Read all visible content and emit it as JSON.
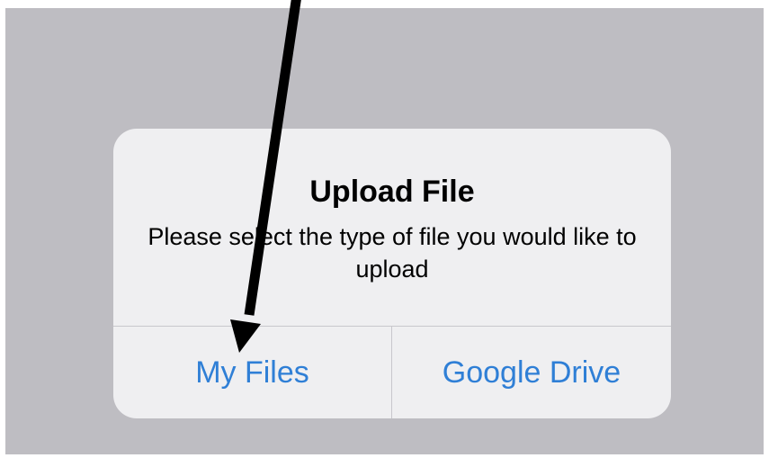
{
  "dialog": {
    "title": "Upload File",
    "message": "Please select the type of file you would like to upload",
    "actions": [
      {
        "label": "My Files"
      },
      {
        "label": "Google Drive"
      }
    ]
  },
  "colors": {
    "backdrop": "#bebdc2",
    "dialog_background": "#efeff1",
    "action_text": "#2f7fd6",
    "annotation_arrow": "#000000"
  },
  "annotation": {
    "type": "arrow",
    "points_to": "My Files"
  }
}
